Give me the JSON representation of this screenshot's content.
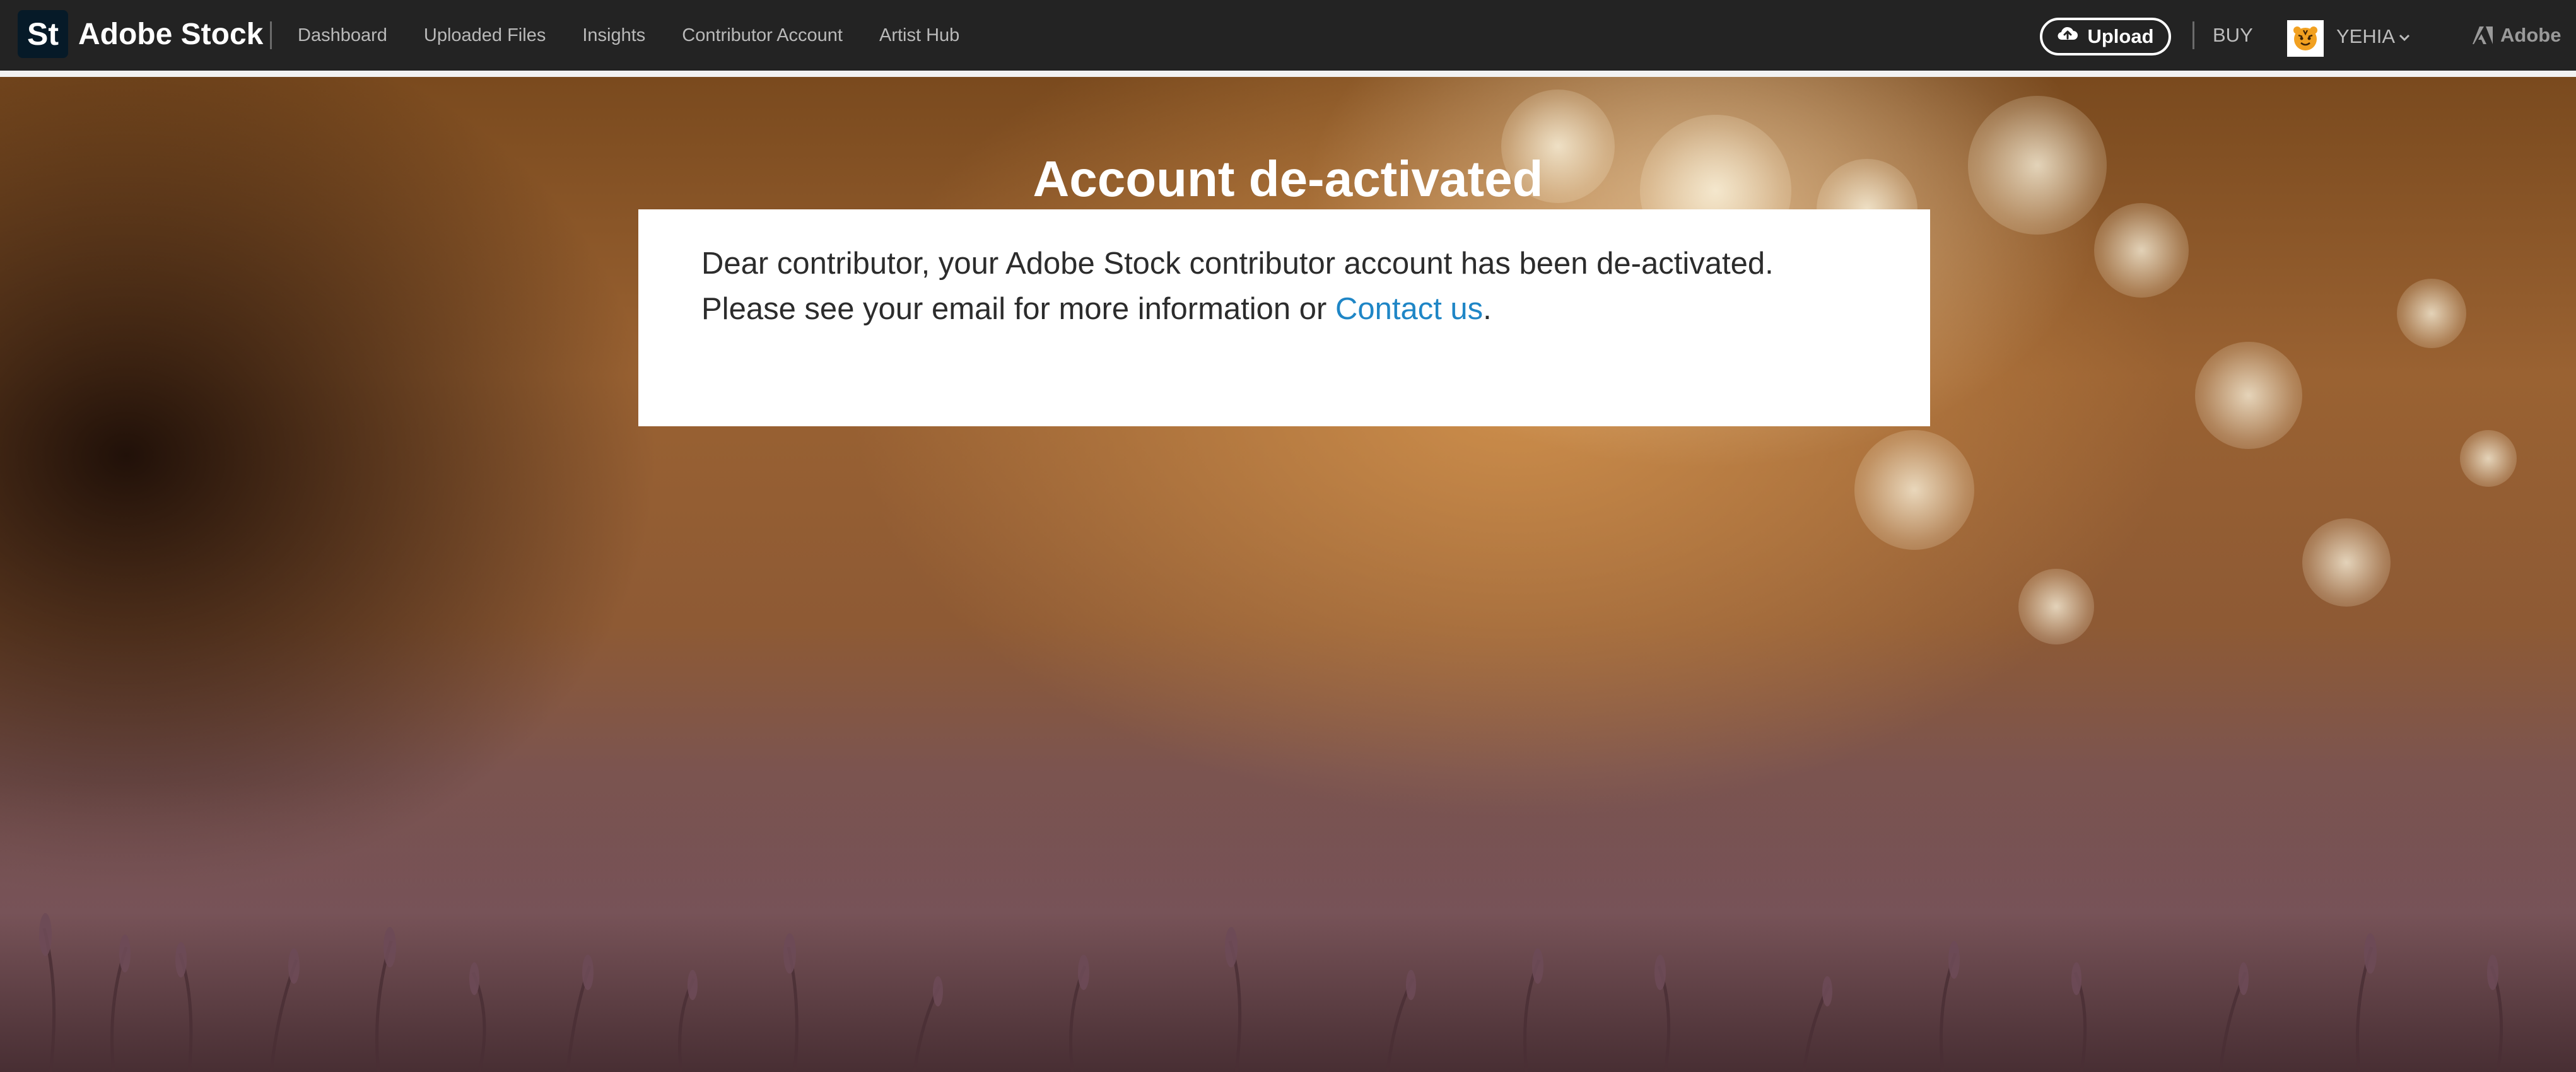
{
  "brand": {
    "logo_text": "St",
    "name": "Adobe Stock"
  },
  "nav": {
    "items": [
      {
        "label": "Dashboard"
      },
      {
        "label": "Uploaded Files"
      },
      {
        "label": "Insights"
      },
      {
        "label": "Contributor Account"
      },
      {
        "label": "Artist Hub"
      }
    ]
  },
  "header_right": {
    "upload_label": "Upload",
    "buy_label": "BUY",
    "user_name": "YEHIA",
    "adobe_label": "Adobe"
  },
  "main": {
    "title": "Account de-activated",
    "message": "Dear contributor, your Adobe Stock contributor account has been de-activated. Please see your email for more information or ",
    "contact_link": "Contact us",
    "message_end": "."
  },
  "colors": {
    "topbar": "#232323",
    "link": "#1f86c6",
    "card": "#ffffff"
  }
}
